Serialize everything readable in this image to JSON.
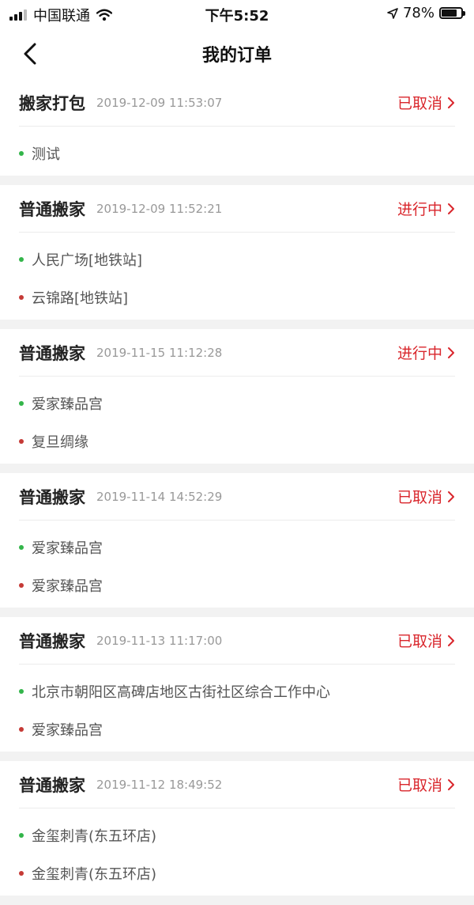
{
  "status_bar": {
    "carrier": "中国联通",
    "time": "下午5:52",
    "battery": "78%",
    "battery_level": 0.78
  },
  "header": {
    "title": "我的订单"
  },
  "colors": {
    "accent": "#d9262c",
    "start_dot": "#33b54a",
    "end_dot": "#c53a36"
  },
  "orders": [
    {
      "type": "搬家打包",
      "time": "2019-12-09 11:53:07",
      "status": "已取消",
      "start": "测试",
      "end": null
    },
    {
      "type": "普通搬家",
      "time": "2019-12-09 11:52:21",
      "status": "进行中",
      "start": "人民广场[地铁站]",
      "end": "云锦路[地铁站]"
    },
    {
      "type": "普通搬家",
      "time": "2019-11-15 11:12:28",
      "status": "进行中",
      "start": "爱家臻品宫",
      "end": "复旦绸缘"
    },
    {
      "type": "普通搬家",
      "time": "2019-11-14 14:52:29",
      "status": "已取消",
      "start": "爱家臻品宫",
      "end": "爱家臻品宫"
    },
    {
      "type": "普通搬家",
      "time": "2019-11-13 11:17:00",
      "status": "已取消",
      "start": "北京市朝阳区高碑店地区古街社区综合工作中心",
      "end": "爱家臻品宫"
    },
    {
      "type": "普通搬家",
      "time": "2019-11-12 18:49:52",
      "status": "已取消",
      "start": "金玺刺青(东五环店)",
      "end": "金玺刺青(东五环店)"
    }
  ]
}
